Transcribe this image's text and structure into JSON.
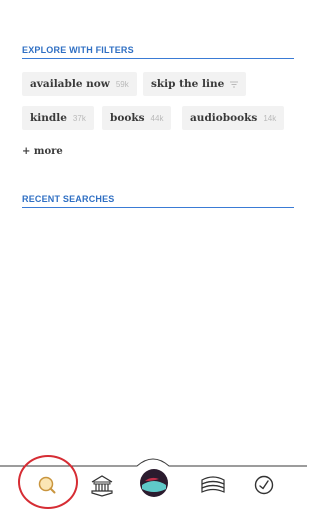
{
  "explore": {
    "title": "EXPLORE WITH FILTERS",
    "chips": [
      {
        "label": "available now",
        "count": "59k"
      },
      {
        "label": "skip the line",
        "icon": "filter-icon"
      },
      {
        "label": "kindle",
        "count": "37k"
      },
      {
        "label": "books",
        "count": "44k"
      },
      {
        "label": "audiobooks",
        "count": "14k"
      }
    ],
    "more_label": "+ more"
  },
  "recent": {
    "title": "RECENT SEARCHES"
  },
  "tabbar": {
    "items": [
      {
        "icon": "search-icon",
        "selected": true
      },
      {
        "icon": "library-icon"
      },
      {
        "icon": "profile-avatar-icon"
      },
      {
        "icon": "shelf-icon"
      },
      {
        "icon": "activity-clock-icon"
      }
    ]
  },
  "colors": {
    "accent": "#2f6fc3",
    "chip_bg": "#f2f2f2",
    "annotation_ring": "#d62d34"
  }
}
